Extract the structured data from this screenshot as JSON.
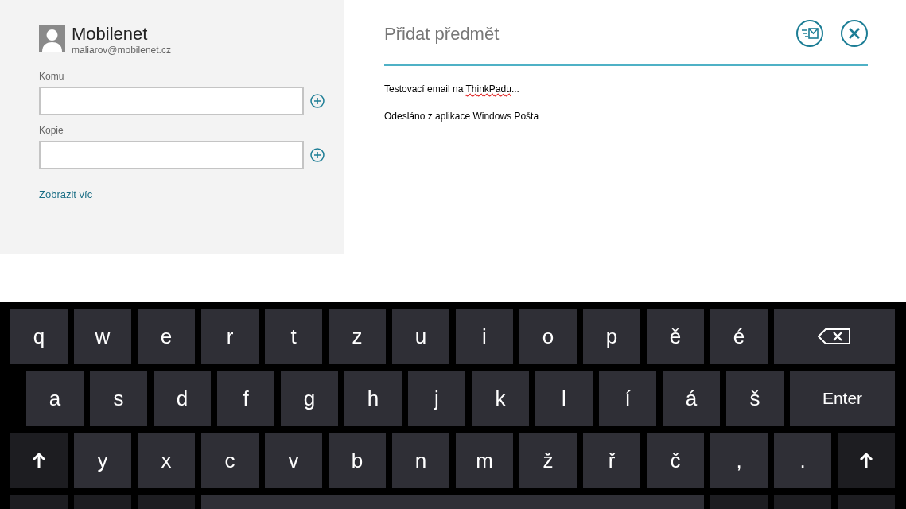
{
  "account": {
    "name": "Mobilenet",
    "email": "maliarov@mobilenet.cz"
  },
  "fields": [
    {
      "label": "Komu"
    },
    {
      "label": "Kopie"
    }
  ],
  "show_more": "Zobrazit víc",
  "subject": {
    "placeholder": "Přidat předmět"
  },
  "body": [
    {
      "text": "Testovací email na ",
      "misspelled": "ThinkPadu",
      "after": "..."
    },
    {
      "text": "Odesláno z aplikace Windows Pošta"
    }
  ],
  "keyboard": {
    "rows": [
      [
        {
          "kind": "char",
          "label": "q"
        },
        {
          "kind": "char",
          "label": "w"
        },
        {
          "kind": "char",
          "label": "e"
        },
        {
          "kind": "char",
          "label": "r"
        },
        {
          "kind": "char",
          "label": "t"
        },
        {
          "kind": "char",
          "label": "z"
        },
        {
          "kind": "char",
          "label": "u"
        },
        {
          "kind": "char",
          "label": "i"
        },
        {
          "kind": "char",
          "label": "o"
        },
        {
          "kind": "char",
          "label": "p"
        },
        {
          "kind": "char",
          "label": "ě"
        },
        {
          "kind": "char",
          "label": "é"
        },
        {
          "kind": "backspace"
        }
      ],
      [
        {
          "kind": "char",
          "label": "a"
        },
        {
          "kind": "char",
          "label": "s"
        },
        {
          "kind": "char",
          "label": "d"
        },
        {
          "kind": "char",
          "label": "f"
        },
        {
          "kind": "char",
          "label": "g"
        },
        {
          "kind": "char",
          "label": "h"
        },
        {
          "kind": "char",
          "label": "j"
        },
        {
          "kind": "char",
          "label": "k"
        },
        {
          "kind": "char",
          "label": "l"
        },
        {
          "kind": "char",
          "label": "í"
        },
        {
          "kind": "char",
          "label": "á"
        },
        {
          "kind": "char",
          "label": "š"
        },
        {
          "kind": "enter",
          "label": "Enter"
        }
      ],
      [
        {
          "kind": "shift"
        },
        {
          "kind": "char",
          "label": "y"
        },
        {
          "kind": "char",
          "label": "x"
        },
        {
          "kind": "char",
          "label": "c"
        },
        {
          "kind": "char",
          "label": "v"
        },
        {
          "kind": "char",
          "label": "b"
        },
        {
          "kind": "char",
          "label": "n"
        },
        {
          "kind": "char",
          "label": "m"
        },
        {
          "kind": "char",
          "label": "ž"
        },
        {
          "kind": "char",
          "label": "ř"
        },
        {
          "kind": "char",
          "label": "č"
        },
        {
          "kind": "char",
          "label": ","
        },
        {
          "kind": "char",
          "label": "."
        },
        {
          "kind": "shift"
        }
      ],
      [
        {
          "kind": "function"
        },
        {
          "kind": "function"
        },
        {
          "kind": "function"
        },
        {
          "kind": "space"
        },
        {
          "kind": "function"
        },
        {
          "kind": "function"
        },
        {
          "kind": "function"
        }
      ]
    ]
  }
}
